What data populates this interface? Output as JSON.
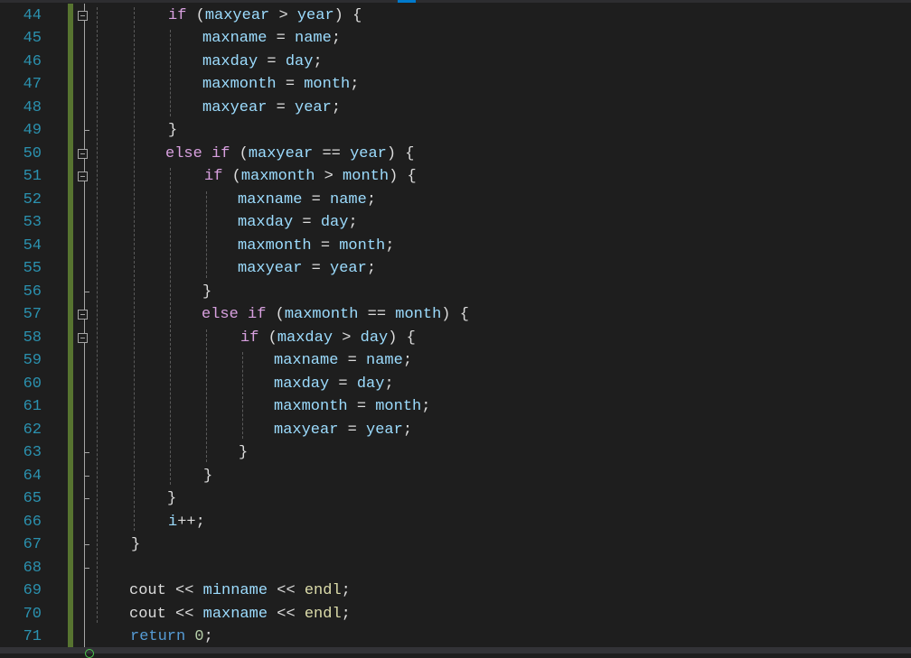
{
  "editor": {
    "lines": [
      {
        "n": "44",
        "code": "if (maxyear > year) {"
      },
      {
        "n": "45",
        "code": "maxname = name;"
      },
      {
        "n": "46",
        "code": "maxday = day;"
      },
      {
        "n": "47",
        "code": "maxmonth = month;"
      },
      {
        "n": "48",
        "code": "maxyear = year;"
      },
      {
        "n": "49",
        "code": "}"
      },
      {
        "n": "50",
        "code": "else if (maxyear == year) {"
      },
      {
        "n": "51",
        "code": "if (maxmonth > month) {"
      },
      {
        "n": "52",
        "code": "maxname = name;"
      },
      {
        "n": "53",
        "code": "maxday = day;"
      },
      {
        "n": "54",
        "code": "maxmonth = month;"
      },
      {
        "n": "55",
        "code": "maxyear = year;"
      },
      {
        "n": "56",
        "code": "}"
      },
      {
        "n": "57",
        "code": "else if (maxmonth == month) {"
      },
      {
        "n": "58",
        "code": "if (maxday > day) {"
      },
      {
        "n": "59",
        "code": "maxname = name;"
      },
      {
        "n": "60",
        "code": "maxday = day;"
      },
      {
        "n": "61",
        "code": "maxmonth = month;"
      },
      {
        "n": "62",
        "code": "maxyear = year;"
      },
      {
        "n": "63",
        "code": "}"
      },
      {
        "n": "64",
        "code": "}"
      },
      {
        "n": "65",
        "code": "}"
      },
      {
        "n": "66",
        "code": "i++;"
      },
      {
        "n": "67",
        "code": "}"
      },
      {
        "n": "68",
        "code": ""
      },
      {
        "n": "69",
        "code": "cout << minname << endl;"
      },
      {
        "n": "70",
        "code": "cout << maxname << endl;"
      },
      {
        "n": "71",
        "code": "return 0;"
      }
    ]
  },
  "colors": {
    "background": "#1e1e1e",
    "line_number": "#2b91af",
    "keyword": "#d8a0df",
    "variable": "#9cdcfe",
    "function": "#dcdcaa",
    "number": "#b5cea8",
    "change_bar": "#577430"
  }
}
